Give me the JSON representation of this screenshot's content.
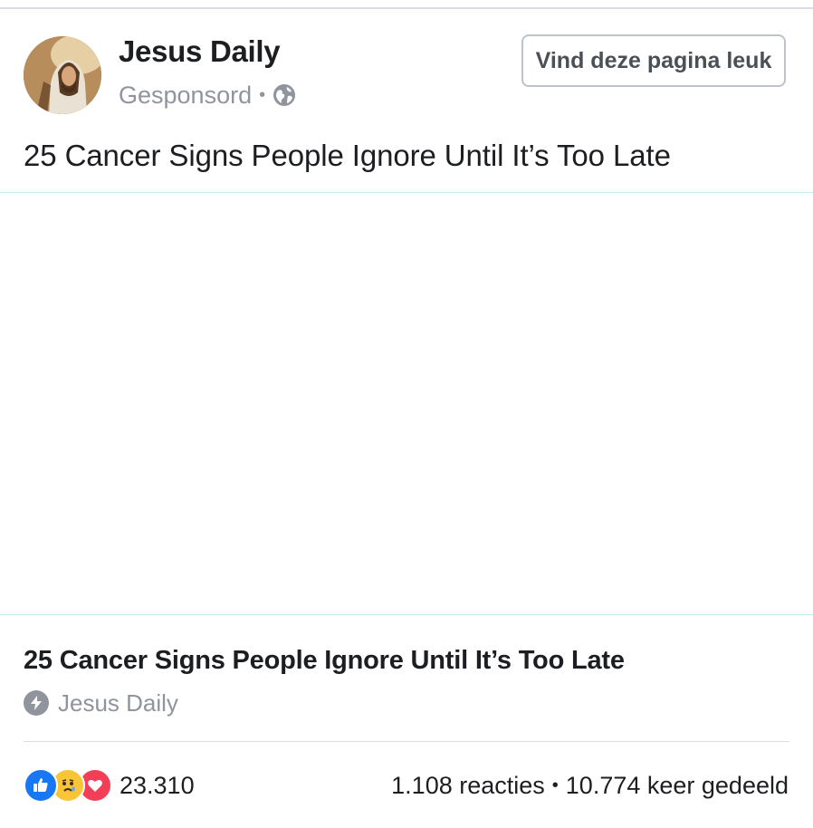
{
  "post": {
    "page_name": "Jesus Daily",
    "sponsored_label": "Gesponsord",
    "separator": "•",
    "privacy_icon": "globe-icon",
    "like_page_button": "Vind deze pagina leuk",
    "text": "25 Cancer Signs People Ignore Until It’s Too Late"
  },
  "link_preview": {
    "title": "25 Cancer Signs People Ignore Until It’s Too Late",
    "source_icon": "bolt-icon",
    "source": "Jesus Daily"
  },
  "footer": {
    "reaction_icons": [
      "like-icon",
      "sad-icon",
      "love-icon"
    ],
    "reaction_count": "23.310",
    "comments": "1.108 reacties",
    "separator": "•",
    "shares": "10.774 keer gedeeld"
  },
  "colors": {
    "like_blue": "#1877f2",
    "love_red": "#f33e58",
    "sad_yellow": "#f7c536",
    "meta_gray": "#90949c"
  }
}
